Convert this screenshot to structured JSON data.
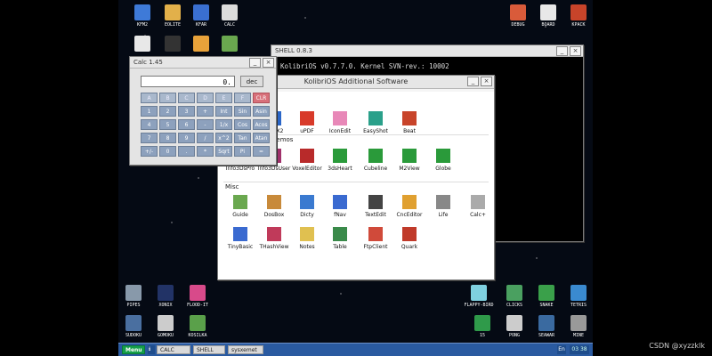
{
  "desktop_icons_top": [
    {
      "label": "KFM2",
      "color": "#3e7ad8",
      "icon": "floppy-icon"
    },
    {
      "label": "EOLITE",
      "color": "#e2b04a",
      "icon": "folder-icon"
    },
    {
      "label": "KFAR",
      "color": "#3a6fd0",
      "icon": "file-manager-icon"
    },
    {
      "label": "CALC",
      "color": "#dcdcdc",
      "icon": "calculator-icon"
    },
    {
      "label": "DEBUG",
      "color": "#d95b3a",
      "icon": "debug-icon"
    },
    {
      "label": "BOARD",
      "color": "#e8e8e8",
      "icon": "board-icon"
    },
    {
      "label": "KPACK",
      "color": "#c8442a",
      "icon": "kpack-icon"
    }
  ],
  "desktop_icons_row2": [
    {
      "color": "#e8e8e8",
      "icon": "notepad-icon"
    },
    {
      "color": "#333",
      "icon": "code-icon"
    },
    {
      "color": "#e8a23a",
      "icon": "tools-icon"
    },
    {
      "color": "#6aa84f",
      "icon": "cube-icon"
    }
  ],
  "desktop_icons_bottom": [
    {
      "label": "PIPES",
      "color": "#8899aa",
      "icon": "pipes-icon"
    },
    {
      "label": "XONIX",
      "color": "#223366",
      "icon": "xonix-icon"
    },
    {
      "label": "FLOOD-IT",
      "color": "#d84a8a",
      "icon": "flood-it-icon"
    },
    {
      "label": "SUDOKU",
      "color": "#4a6fa0",
      "icon": "sudoku-icon"
    },
    {
      "label": "GOMOKU",
      "color": "#cccccc",
      "icon": "gomoku-icon"
    },
    {
      "label": "KOSILKA",
      "color": "#5aa04a",
      "icon": "kosilka-icon"
    },
    {
      "label": "FLAPPY-BIRD",
      "color": "#7fd0e0",
      "icon": "bird-icon"
    },
    {
      "label": "CLICKS",
      "color": "#4aa060",
      "icon": "clicks-icon"
    },
    {
      "label": "SNAKE",
      "color": "#3aa04a",
      "icon": "snake-icon"
    },
    {
      "label": "TETRIS",
      "color": "#3a8ad0",
      "icon": "tetris-icon"
    },
    {
      "label": "15",
      "color": "#2f9a4a",
      "icon": "fifteen-icon"
    },
    {
      "label": "PONG",
      "color": "#cccccc",
      "icon": "pong-icon"
    },
    {
      "label": "SEAWAR",
      "color": "#3a6aa0",
      "icon": "seawar-icon"
    },
    {
      "label": "MINE",
      "color": "#999999",
      "icon": "mine-icon"
    }
  ],
  "shell": {
    "title": "SHELL 0.8.3",
    "text": "KolibriOS v0.7.7.0. Kernel SVN-rev.: 10002"
  },
  "calc": {
    "title": "Calc 1.45",
    "display": "0.",
    "mode": "dec",
    "keys": [
      [
        "A",
        "B",
        "C",
        "D",
        "E",
        "F",
        "CLR"
      ],
      [
        "1",
        "2",
        "3",
        "+",
        "Int",
        "Sin",
        "Asin"
      ],
      [
        "4",
        "5",
        "6",
        "-",
        "1/x",
        "Cos",
        "Acos"
      ],
      [
        "7",
        "8",
        "9",
        "/",
        "x^2",
        "Tan",
        "Atan"
      ],
      [
        "+/-",
        "0",
        ".",
        "*",
        "Sqrt",
        "Pi",
        "="
      ]
    ]
  },
  "addsw": {
    "title": "KolibriOS Additional Software",
    "sections": {
      "demos": "Demos",
      "misc": "Misc"
    },
    "row1": [
      {
        "label": "y",
        "color": "#555",
        "icon": "partial-icon"
      },
      {
        "label": "GrafX2",
        "color": "#2a66c8",
        "icon": "grafx2-icon"
      },
      {
        "label": "uPDF",
        "color": "#d83a2a",
        "icon": "pdf-icon"
      },
      {
        "label": "IconEdit",
        "color": "#e888b8",
        "icon": "iconedit-icon"
      },
      {
        "label": "EasyShot",
        "color": "#2aa08a",
        "icon": "easyshot-icon"
      },
      {
        "label": "Beat",
        "color": "#c8442a",
        "icon": "metronome-icon"
      }
    ],
    "demos": [
      {
        "label": "Info3DsPro",
        "color": "#a0306a",
        "icon": "info3ds-pro-icon"
      },
      {
        "label": "Info3DsUser",
        "color": "#a0306a",
        "icon": "info3ds-user-icon"
      },
      {
        "label": "VoxelEditor",
        "color": "#b82a2a",
        "icon": "voxel-icon"
      },
      {
        "label": "3dsHeart",
        "color": "#2a9a3a",
        "icon": "heart3d-icon"
      },
      {
        "label": "Cubeline",
        "color": "#2a9a3a",
        "icon": "cubeline-icon"
      },
      {
        "label": "M2View",
        "color": "#2a9a3a",
        "icon": "m2view-icon"
      },
      {
        "label": "Globe",
        "color": "#2a9a3a",
        "icon": "globe-icon"
      }
    ],
    "misc1": [
      {
        "label": "Guide",
        "color": "#6aa84f",
        "icon": "guide-icon"
      },
      {
        "label": "DosBox",
        "color": "#c88a3a",
        "icon": "dosbox-icon"
      },
      {
        "label": "Dicty",
        "color": "#3a7ad0",
        "icon": "dicty-icon"
      },
      {
        "label": "fNav",
        "color": "#3a6ad0",
        "icon": "fnav-icon"
      },
      {
        "label": "TextEdit",
        "color": "#444",
        "icon": "textedit-icon"
      },
      {
        "label": "CncEditor",
        "color": "#e0a030",
        "icon": "cnc-icon"
      },
      {
        "label": "Life",
        "color": "#888",
        "icon": "life-icon"
      },
      {
        "label": "Calc+",
        "color": "#aaa",
        "icon": "calcplus-icon"
      }
    ],
    "misc2": [
      {
        "label": "TinyBasic",
        "color": "#3a6ad0",
        "icon": "tinybasic-icon"
      },
      {
        "label": "THashView",
        "color": "#c03a5a",
        "icon": "thash-icon"
      },
      {
        "label": "Notes",
        "color": "#e0c050",
        "icon": "notes-icon"
      },
      {
        "label": "Table",
        "color": "#3a8a4a",
        "icon": "table-icon"
      },
      {
        "label": "FtpClient",
        "color": "#d04a3a",
        "icon": "ftp-icon"
      },
      {
        "label": "Quark",
        "color": "#c03a2a",
        "icon": "quark-icon"
      }
    ]
  },
  "taskbar": {
    "menu": "Menu",
    "tasks": [
      "CALC",
      "SHELL",
      "sysxemet"
    ],
    "lang": "En",
    "clock": "03 38"
  },
  "watermark": "CSDN @xyzzklk"
}
